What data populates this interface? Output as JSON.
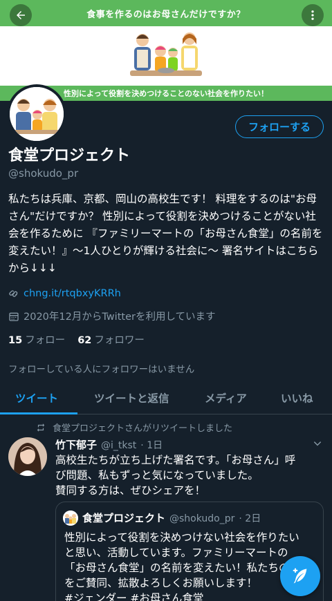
{
  "banner": {
    "title": "食事を作るのはお母さんだけですか？",
    "slogan": "性別によって役割を決めつけることのない社会を作りたい！"
  },
  "header": {
    "back_icon": "arrow-left-icon",
    "more_icon": "more-vertical-icon"
  },
  "profile": {
    "follow_label": "フォローする",
    "name": "食堂プロジェクト",
    "handle": "@shokudo_pr",
    "bio": "私たちは兵庫、京都、岡山の高校生です！ 料理をするのは\"お母さん\"だけですか？ 性別によって役割を決めつけることがない社会を作るために 『ファミリーマートの「お母さん食堂」の名前を変えたい！』〜1人ひとりが輝ける社会に〜 署名サイトはこちらから↓↓↓",
    "link": "chng.it/rtqbxyKRRh",
    "joined": "2020年12月からTwitterを利用しています",
    "following_count": "15",
    "following_label": "フォロー",
    "followers_count": "62",
    "followers_label": "フォロワー",
    "no_followers_you_know": "フォローしている人にフォロワーはいません"
  },
  "tabs": [
    {
      "label": "ツイート"
    },
    {
      "label": "ツイートと返信"
    },
    {
      "label": "メディア"
    },
    {
      "label": "いいね"
    }
  ],
  "tweet": {
    "retweet_note": "食堂プロジェクトさんがリツイートしました",
    "author_name": "竹下郁子",
    "author_handle": "@i_tkst",
    "time": "· 1日",
    "text_line1": "高校生たちが立ち上げた署名です。「お母さん」呼",
    "text_line2": "び問題、私もずっと気になっていました。",
    "text_line3": "賛同する方は、ぜひシェアを！",
    "quote": {
      "author_name": "食堂プロジェクト",
      "author_handle": "@shokudo_pr",
      "time": "· 2日",
      "line1": "性別によって役割を決めつけない社会を作りたい",
      "line2": "と思い、活動しています。ファミリーマートの",
      "line3": "「お母さん食堂」の名前を変えたい！私たちの",
      "line4": "をご賛同、拡散よろしくお願いします！",
      "line5": "#ジェンダー #お母さん食堂"
    }
  },
  "colors": {
    "background": "#15202b",
    "accent": "#1da1f2",
    "banner_green": "#5cb85c",
    "secondary_text": "#8899a6"
  }
}
